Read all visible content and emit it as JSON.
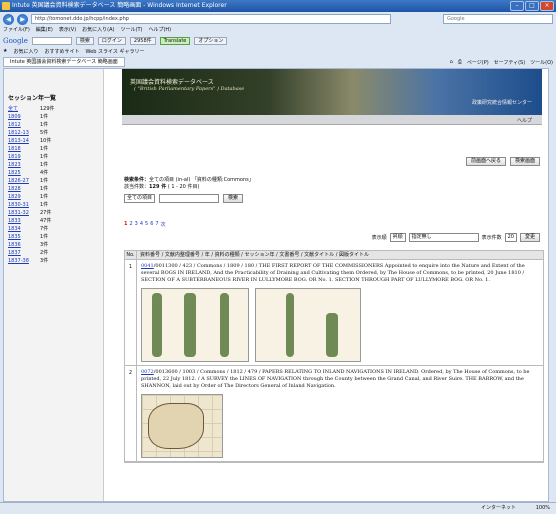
{
  "window": {
    "title": "Intute 英国議会資料検索データベース 簡略画面 - Windows Internet Explorer",
    "address": "http://tomonet.ddo.jp/hcpp/index.php",
    "search_placeholder": "Google"
  },
  "menu": [
    "ファイル(F)",
    "編集(E)",
    "表示(V)",
    "お気に入り(A)",
    "ツール(T)",
    "ヘルプ(H)"
  ],
  "google_toolbar": {
    "logo": "Google",
    "search_label": "検索",
    "chip_login": "ログイン",
    "chip_hits": "2958件",
    "chip_translate": "Translate",
    "chip_options": "オプション"
  },
  "favorites": {
    "label": "お気に入り",
    "items": [
      "おすすめサイト",
      "Web スライス ギャラリー"
    ]
  },
  "tab": {
    "label": "Intute 英国議会資料検索データベース 簡略画面"
  },
  "command_bar": [
    "ページ(P)",
    "セーフティ(S)",
    "ツール(O)"
  ],
  "sidebar": {
    "title": "セッション年一覧",
    "items": [
      {
        "label": "全て",
        "count": "129件"
      },
      {
        "label": "1809",
        "count": "1件"
      },
      {
        "label": "1812",
        "count": "1件"
      },
      {
        "label": "1812-13",
        "count": "5件"
      },
      {
        "label": "1813-14",
        "count": "10件"
      },
      {
        "label": "1818",
        "count": "1件"
      },
      {
        "label": "1819",
        "count": "1件"
      },
      {
        "label": "1823",
        "count": "1件"
      },
      {
        "label": "1825",
        "count": "4件"
      },
      {
        "label": "1826-27",
        "count": "1件"
      },
      {
        "label": "1828",
        "count": "1件"
      },
      {
        "label": "1829",
        "count": "1件"
      },
      {
        "label": "1830-31",
        "count": "1件"
      },
      {
        "label": "1831-32",
        "count": "27件"
      },
      {
        "label": "1833",
        "count": "47件"
      },
      {
        "label": "1834",
        "count": "7件"
      },
      {
        "label": "1835",
        "count": "1件"
      },
      {
        "label": "1836",
        "count": "3件"
      },
      {
        "label": "1837",
        "count": "2件"
      },
      {
        "label": "1837-38",
        "count": "3件"
      }
    ]
  },
  "banner": {
    "title": "英国議会資料検索データベース",
    "subtitle": "( \"British Parliamentary Papers\" ) Database",
    "org": "政策研究統合情報センター",
    "help": "ヘルプ"
  },
  "buttons": {
    "back": "前画面へ戻る",
    "new_search": "検索画面"
  },
  "conditions": {
    "label": "検索条件：",
    "text": "全ての項目 (in-al) 「資料の種類:Commons」",
    "count_label": "該当件数：",
    "count": "129 件",
    "range": "( 1 - 20 件目)"
  },
  "query": {
    "field": "全ての項目",
    "submit": "検索"
  },
  "pagination": {
    "current": "1",
    "pages": [
      "2",
      "3",
      "4",
      "5",
      "6",
      "7"
    ],
    "next": "次"
  },
  "sort": {
    "label": "表示順",
    "order": "昇順",
    "by": "指定無し",
    "count_label": "表示件数",
    "count": "20",
    "apply": "変更"
  },
  "table": {
    "header_no": "No.",
    "header": "資料番号 / 文献内整理番号 / 年 / 資料の種類 / セッション年 / 文書番号 / 文献タイトル / 図版タイトル",
    "rows": [
      {
        "no": "1",
        "link": "0041",
        "text": "/0011300 / 423 / Commons / 1809 / 180 / THE FIRST REPORT OF THE COMMISSIONERS Appointed to enquire into the Nature and Extent of the several BOGS IN IRELAND, And the Practicability of Draining and Cultivating them Ordered, by The House of Commons, to be printed, 20 June 1810 / SECTION OF A SUBTERRANEOUS RIVER IN LULLYMORE BOG. OR No. 1. SECTION THROUGH PART OF LULLYMORE BOG. OR No. 1."
      },
      {
        "no": "2",
        "link": "0072",
        "text": "/0013600 / 1003 / Commons / 1812 / 479 / PAPERS RELATING TO INLAND NAVIGATIONS IN IRELAND. Ordered, by The House of Commons, to be printed, 22 July 1812. / A SURVEY the LINES OF NAVIGATION through the County between the Grand Canal, and River Suire. THE BARROW, and the SHANNON, laid out by Order of The Directors General of Inland Navigation."
      }
    ]
  },
  "status": {
    "zone": "インターネット",
    "zoom": "100%"
  }
}
